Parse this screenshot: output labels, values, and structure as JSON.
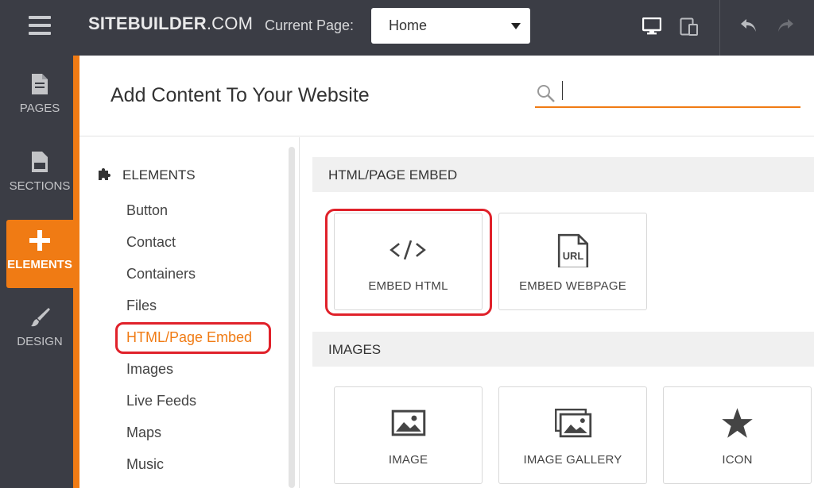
{
  "topbar": {
    "brand_bold": "SITEBUILDER",
    "brand_light": ".COM",
    "current_page_label": "Current Page:",
    "current_page_value": "Home",
    "icons": [
      "menu-icon",
      "desktop-icon",
      "tablet-icon",
      "undo-icon",
      "redo-icon"
    ]
  },
  "sidebar": {
    "items": [
      {
        "label": "PAGES",
        "icon": "page-icon"
      },
      {
        "label": "SECTIONS",
        "icon": "sections-icon"
      },
      {
        "label": "ELEMENTS",
        "icon": "plus-icon",
        "active": true
      },
      {
        "label": "DESIGN",
        "icon": "brush-icon"
      }
    ]
  },
  "header": {
    "title": "Add Content To Your Website",
    "search_value": ""
  },
  "categories": {
    "heading": "ELEMENTS",
    "items": [
      "Button",
      "Contact",
      "Containers",
      "Files",
      "HTML/Page Embed",
      "Images",
      "Live Feeds",
      "Maps",
      "Music"
    ],
    "active": "HTML/Page Embed"
  },
  "sections": [
    {
      "title": "HTML/PAGE EMBED",
      "tiles": [
        {
          "label": "EMBED HTML",
          "icon": "code-icon"
        },
        {
          "label": "EMBED WEBPAGE",
          "icon": "url-file-icon"
        }
      ]
    },
    {
      "title": "IMAGES",
      "tiles": [
        {
          "label": "IMAGE",
          "icon": "image-icon"
        },
        {
          "label": "IMAGE GALLERY",
          "icon": "image-gallery-icon"
        },
        {
          "label": "ICON",
          "icon": "star-icon"
        }
      ]
    }
  ],
  "colors": {
    "topbar": "#3b3d45",
    "accent": "#f07b14",
    "highlight": "#e0212a"
  }
}
